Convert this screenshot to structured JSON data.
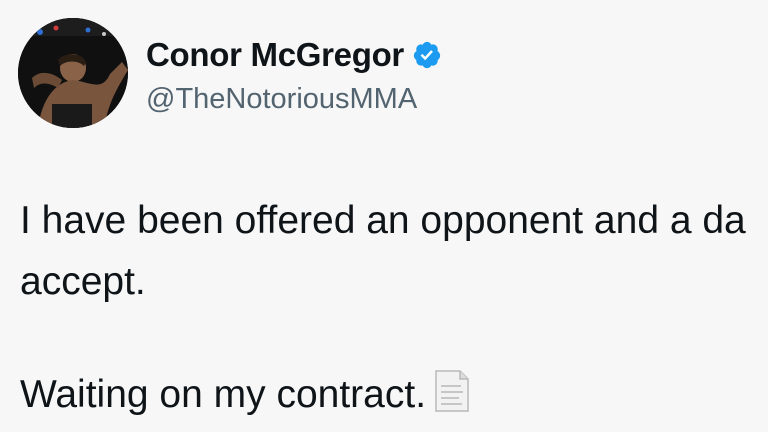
{
  "tweet": {
    "display_name": "Conor McGregor",
    "handle": "@TheNotoriousMMA",
    "verified": true,
    "avatar_icon": "profile-photo",
    "text_line_1": "I have been offered an opponent and a da",
    "text_line_2": "accept.",
    "text_line_3": "Waiting on my contract.",
    "emoji_icon": "page-facing-up-icon"
  },
  "colors": {
    "text": "#0f1419",
    "handle": "#536471",
    "verified_badge": "#1d9bf0",
    "background": "#f7f7f7"
  }
}
